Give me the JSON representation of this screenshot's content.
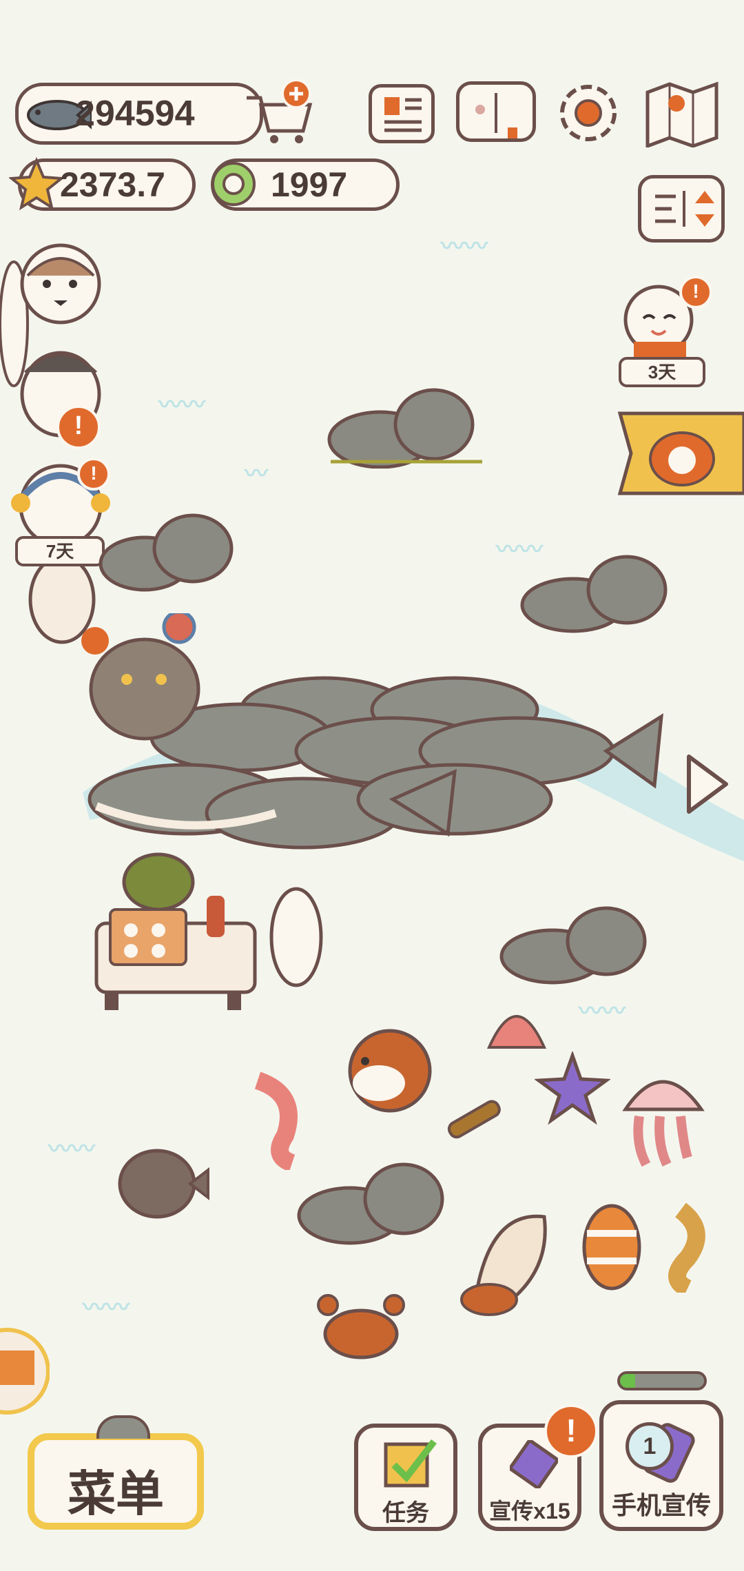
{
  "hud": {
    "fish_amount": "294594",
    "star_amount": "2373.7",
    "ring_amount": "1997"
  },
  "events": {
    "left_event_days": "7天",
    "right_event_days": "3天"
  },
  "bottom": {
    "menu_label": "菜单",
    "tasks_label": "任务",
    "promote_label": "宣传x15",
    "phone_promote_label": "手机宣传",
    "phone_promote_count": "1",
    "promote_badge": "!"
  },
  "icons": [
    "fish-icon",
    "cart-plus-icon",
    "news-icon",
    "book-icon",
    "settings-icon",
    "map-icon",
    "star-icon",
    "ring-icon",
    "sort-icon",
    "arrow-right-icon"
  ],
  "colors": {
    "background": "#f4f6ee",
    "outline": "#6b4f4a",
    "panel": "#fbf6ee",
    "alert": "#e06a2c",
    "menu_border": "#f2c94c",
    "task_check": "#6cbf4a"
  }
}
